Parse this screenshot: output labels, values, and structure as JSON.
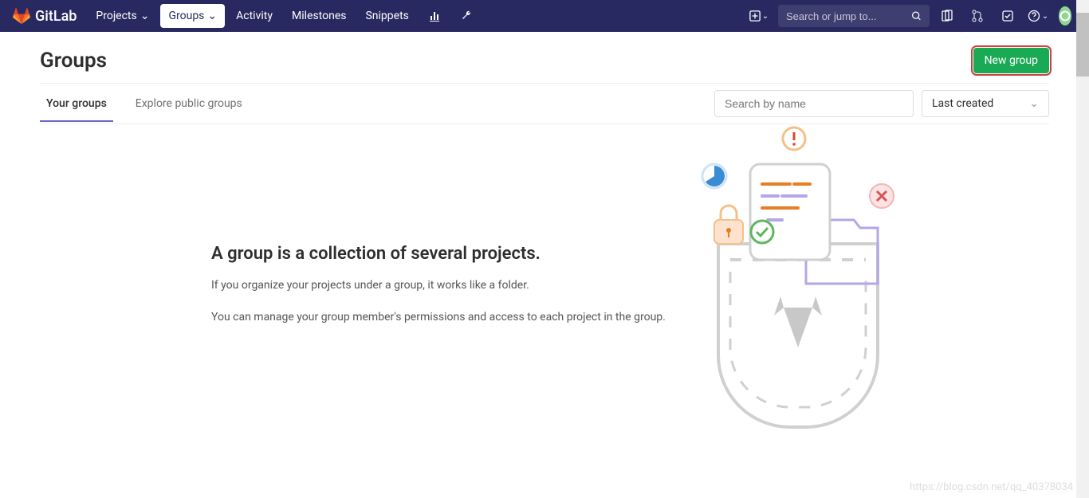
{
  "brand": "GitLab",
  "nav": {
    "projects": "Projects",
    "groups": "Groups",
    "activity": "Activity",
    "milestones": "Milestones",
    "snippets": "Snippets"
  },
  "search_placeholder": "Search or jump to...",
  "page_title": "Groups",
  "new_group_label": "New group",
  "tabs": {
    "your_groups": "Your groups",
    "explore": "Explore public groups"
  },
  "filters": {
    "search_placeholder": "Search by name",
    "sort_label": "Last created"
  },
  "empty": {
    "title": "A group is a collection of several projects.",
    "line1": "If you organize your projects under a group, it works like a folder.",
    "line2": "You can manage your group member's permissions and access to each project in the group."
  },
  "watermark": "https://blog.csdn.net/qq_40378034"
}
